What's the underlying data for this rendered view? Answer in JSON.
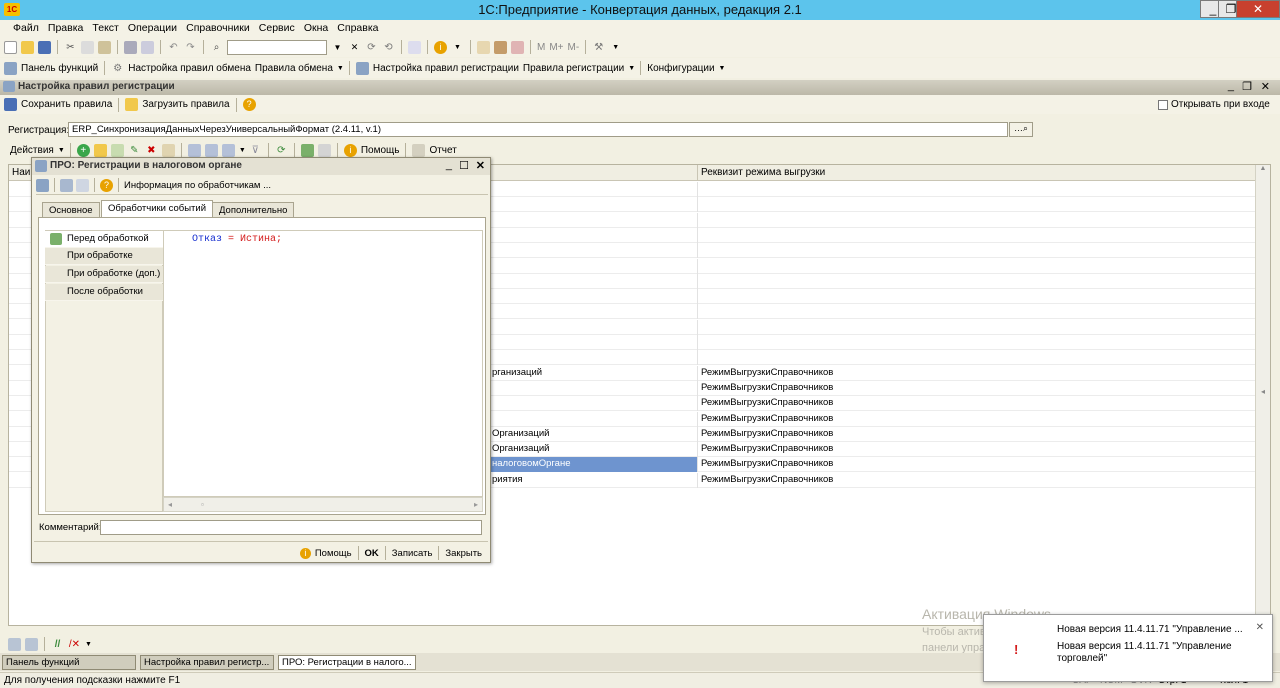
{
  "app": {
    "title": "1С:Предприятие - Конвертация данных, редакция 2.1",
    "logo": "1С"
  },
  "window_buttons": {
    "minimize": "_",
    "restore": "❐",
    "close": "✕"
  },
  "menu": [
    "Файл",
    "Правка",
    "Текст",
    "Операции",
    "Справочники",
    "Сервис",
    "Окна",
    "Справка"
  ],
  "toolbar_main": {
    "zoom_label": "M",
    "mplus_label": "M+",
    "mminus_label": "M-"
  },
  "toolbar_functions": {
    "panel": "Панель функций",
    "exchange_settings": "Настройка правил обмена",
    "exchange_rules": "Правила обмена",
    "registration_settings": "Настройка правил регистрации",
    "registration_rules": "Правила регистрации",
    "configurations": "Конфигурации"
  },
  "doc_window": {
    "title": "Настройка правил регистрации",
    "save_rules": "Сохранить правила",
    "load_rules": "Загрузить правила",
    "open_on_start": "Открывать при входе",
    "registration_label": "Регистрация:",
    "registration_value": "ERP_СинхронизацияДанныхЧерезУниверсальныйФормат (2.4.11, v.1)",
    "actions_label": "Действия",
    "help_label": "Помощь",
    "report_label": "Отчет"
  },
  "grid": {
    "col_name": "Наи",
    "col_mode": "Реквизит режима выгрузки",
    "rows": [
      {
        "name": "",
        "mode": ""
      },
      {
        "name": "",
        "mode": ""
      },
      {
        "name": "",
        "mode": ""
      },
      {
        "name": "",
        "mode": ""
      },
      {
        "name": "",
        "mode": ""
      },
      {
        "name": "",
        "mode": ""
      },
      {
        "name": "",
        "mode": ""
      },
      {
        "name": "",
        "mode": ""
      },
      {
        "name": "",
        "mode": ""
      },
      {
        "name": "",
        "mode": ""
      },
      {
        "name": "",
        "mode": ""
      },
      {
        "name": "",
        "mode": ""
      },
      {
        "name": "рганизаций",
        "mode": "РежимВыгрузкиСправочников"
      },
      {
        "name": "",
        "mode": "РежимВыгрузкиСправочников"
      },
      {
        "name": "",
        "mode": "РежимВыгрузкиСправочников"
      },
      {
        "name": "",
        "mode": "РежимВыгрузкиСправочников"
      },
      {
        "name": "Организаций",
        "mode": "РежимВыгрузкиСправочников"
      },
      {
        "name": "Организаций",
        "mode": "РежимВыгрузкиСправочников"
      },
      {
        "name": "налоговомОргане",
        "mode": "РежимВыгрузкиСправочников"
      },
      {
        "name": "риятия",
        "mode": "РежимВыгрузкиСправочников"
      }
    ]
  },
  "dialog": {
    "title": "ПРО: Регистрации в налоговом органе",
    "info_link": "Информация по обработчикам ...",
    "tabs": [
      "Основное",
      "Обработчики событий",
      "Дополнительно"
    ],
    "events": [
      "Перед обработкой",
      "При обработке",
      "При обработке (доп.)",
      "После обработки"
    ],
    "code_var": "Отказ",
    "code_op": " = ",
    "code_val": "Истина;",
    "comment_label": "Комментарий:",
    "comment_value": "",
    "footer": {
      "help": "Помощь",
      "ok": "OK",
      "write": "Записать",
      "close": "Закрыть"
    }
  },
  "taskbar": [
    "Панель функций",
    "Настройка правил регистр...",
    "ПРО: Регистрации в налого..."
  ],
  "statusbar": {
    "hint": "Для получения подсказки нажмите F1",
    "cap": "CAP",
    "num": "NUM",
    "ovr": "OVR",
    "line": "Стр: 1",
    "col": "Кол: 1"
  },
  "watermark": {
    "line1": "Активация Windows",
    "line2": "Чтобы активировать Windows, перейдите в раздел",
    "line3": "панели управления \"Система\"."
  },
  "toast": {
    "line1": "Новая версия 11.4.11.71 \"Управление ...",
    "line2": "Новая версия 11.4.11.71 \"Управление торговлей\"",
    "close": "✕"
  },
  "colors": {
    "titlebar": "#5cc4ec",
    "selection": "#6e94cf",
    "code_keyword": "#1a32d0",
    "code_value": "#d41c1c"
  }
}
